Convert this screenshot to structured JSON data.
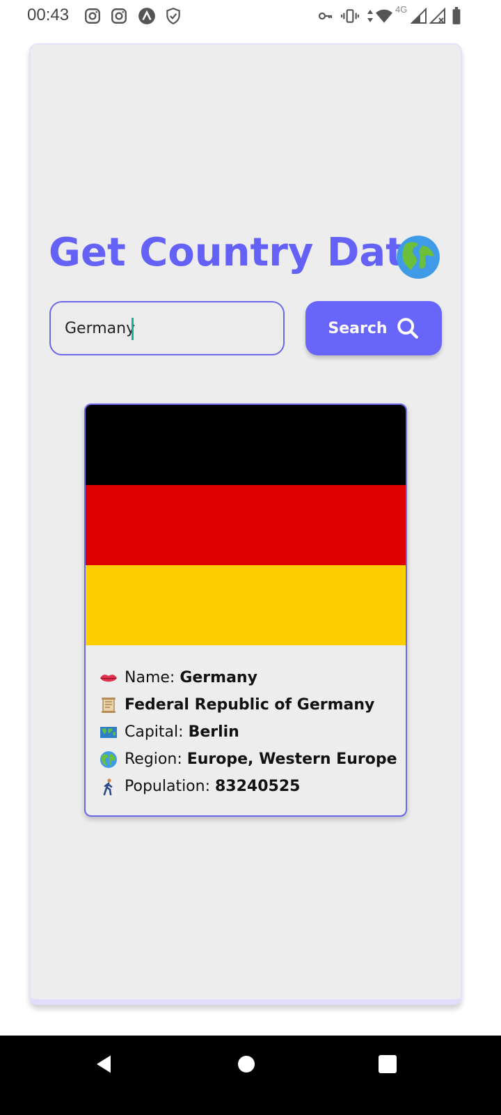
{
  "status_bar": {
    "time": "00:43",
    "left_icons": [
      "instagram-icon",
      "instagram-icon",
      "app-icon",
      "shield-check-icon"
    ],
    "right_icons": [
      "key-icon",
      "vibrate-icon",
      "data-arrows-icon",
      "wifi-icon",
      "signal-icon",
      "signal-x-icon",
      "battery-icon"
    ],
    "network_label": "4G"
  },
  "app": {
    "title": "Get Country Data",
    "title_icon": "globe-americas-icon",
    "accent_color": "#6865fa"
  },
  "search": {
    "value": "Germany",
    "button_label": "Search",
    "button_icon": "search-icon"
  },
  "country": {
    "flag_colors": [
      "#000000",
      "#dd0000",
      "#ffce00"
    ],
    "name_label": "Name:",
    "name": "Germany",
    "official_name": "Federal Republic of Germany",
    "capital_label": "Capital:",
    "capital": "Berlin",
    "region_label": "Region:",
    "region": "Europe, Western Europe",
    "population_label": "Population:",
    "population": "83240525"
  },
  "nav_bar": {
    "buttons": [
      "back-icon",
      "home-icon",
      "recents-icon"
    ]
  }
}
